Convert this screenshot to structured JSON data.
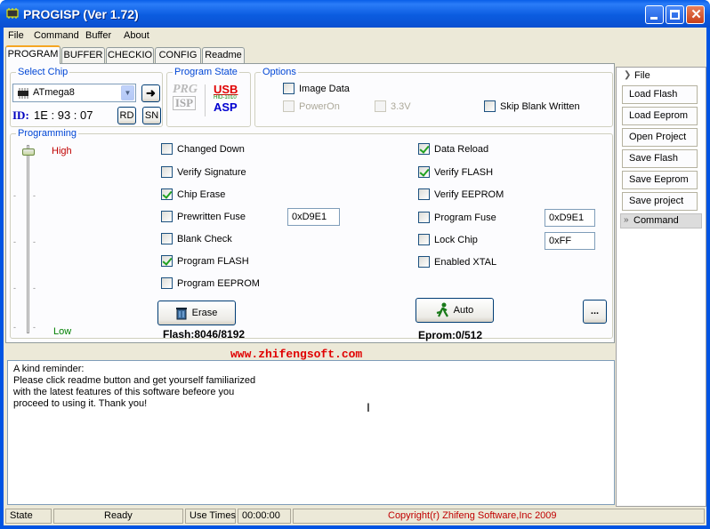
{
  "window": {
    "title": "PROGISP (Ver 1.72)"
  },
  "menu": [
    "File",
    "Command",
    "Buffer",
    "About"
  ],
  "tabs": [
    "PROGRAM",
    "BUFFER",
    "CHECKIO",
    "CONFIG",
    "Readme"
  ],
  "select_chip": {
    "title": "Select Chip",
    "chip": "ATmega8",
    "id_label": "ID:",
    "id_value": "1E : 93 : 07",
    "rd": "RD",
    "sn": "SN"
  },
  "program_state": {
    "title": "Program State",
    "logo_prg": "PRG",
    "logo_isp": "ISP",
    "logo_usb": "USB",
    "logo_asp": "ASP",
    "logo_mid": "HID-1010"
  },
  "options": {
    "title": "Options",
    "image_data": "Image Data",
    "power_on": "PowerOn",
    "v33": "3.3V",
    "skip_blank": "Skip Blank Written"
  },
  "programming": {
    "title": "Programming",
    "high": "High",
    "low": "Low",
    "left": [
      {
        "label": "Changed Down",
        "checked": false
      },
      {
        "label": "Verify Signature",
        "checked": false
      },
      {
        "label": "Chip Erase",
        "checked": true
      },
      {
        "label": "Prewritten Fuse",
        "checked": false
      },
      {
        "label": "Blank Check",
        "checked": false
      },
      {
        "label": "Program FLASH",
        "checked": true
      },
      {
        "label": "Program EEPROM",
        "checked": false
      }
    ],
    "right": [
      {
        "label": "Data Reload",
        "checked": true
      },
      {
        "label": "Verify FLASH",
        "checked": true
      },
      {
        "label": "Verify EEPROM",
        "checked": false
      },
      {
        "label": "Program Fuse",
        "checked": false
      },
      {
        "label": "Lock Chip",
        "checked": false
      },
      {
        "label": "Enabled XTAL",
        "checked": false
      }
    ],
    "prewritten_fuse_value": "0xD9E1",
    "program_fuse_value": "0xD9E1",
    "lock_value": "0xFF",
    "erase_button": "Erase",
    "auto_button": "Auto",
    "more_button": "...",
    "flash_info": "Flash:8046/8192",
    "eprom_info": "Eprom:0/512"
  },
  "website": "www.zhifengsoft.com",
  "log_text": [
    "A kind reminder:",
    "Please click readme button and get yourself familiarized",
    "with the latest features of this software befeore you",
    "proceed to using it. Thank you!"
  ],
  "sidebar": {
    "file_header": "File",
    "file_items": [
      "Load Flash",
      "Load Eeprom",
      "Open Project",
      "Save Flash",
      "Save Eeprom",
      "Save project"
    ],
    "command_header": "Command"
  },
  "status": {
    "state_label": "State",
    "state_value": "Ready",
    "use_times_label": "Use Times",
    "use_times_value": "00:00:00",
    "copyright": "Copyright(r) Zhifeng Software,Inc 2009"
  },
  "colors": {
    "accent_blue": "#0046d5",
    "high_red": "#c00000",
    "low_green": "#008000",
    "web_red": "#e00000",
    "copyright_red": "#c00000"
  }
}
